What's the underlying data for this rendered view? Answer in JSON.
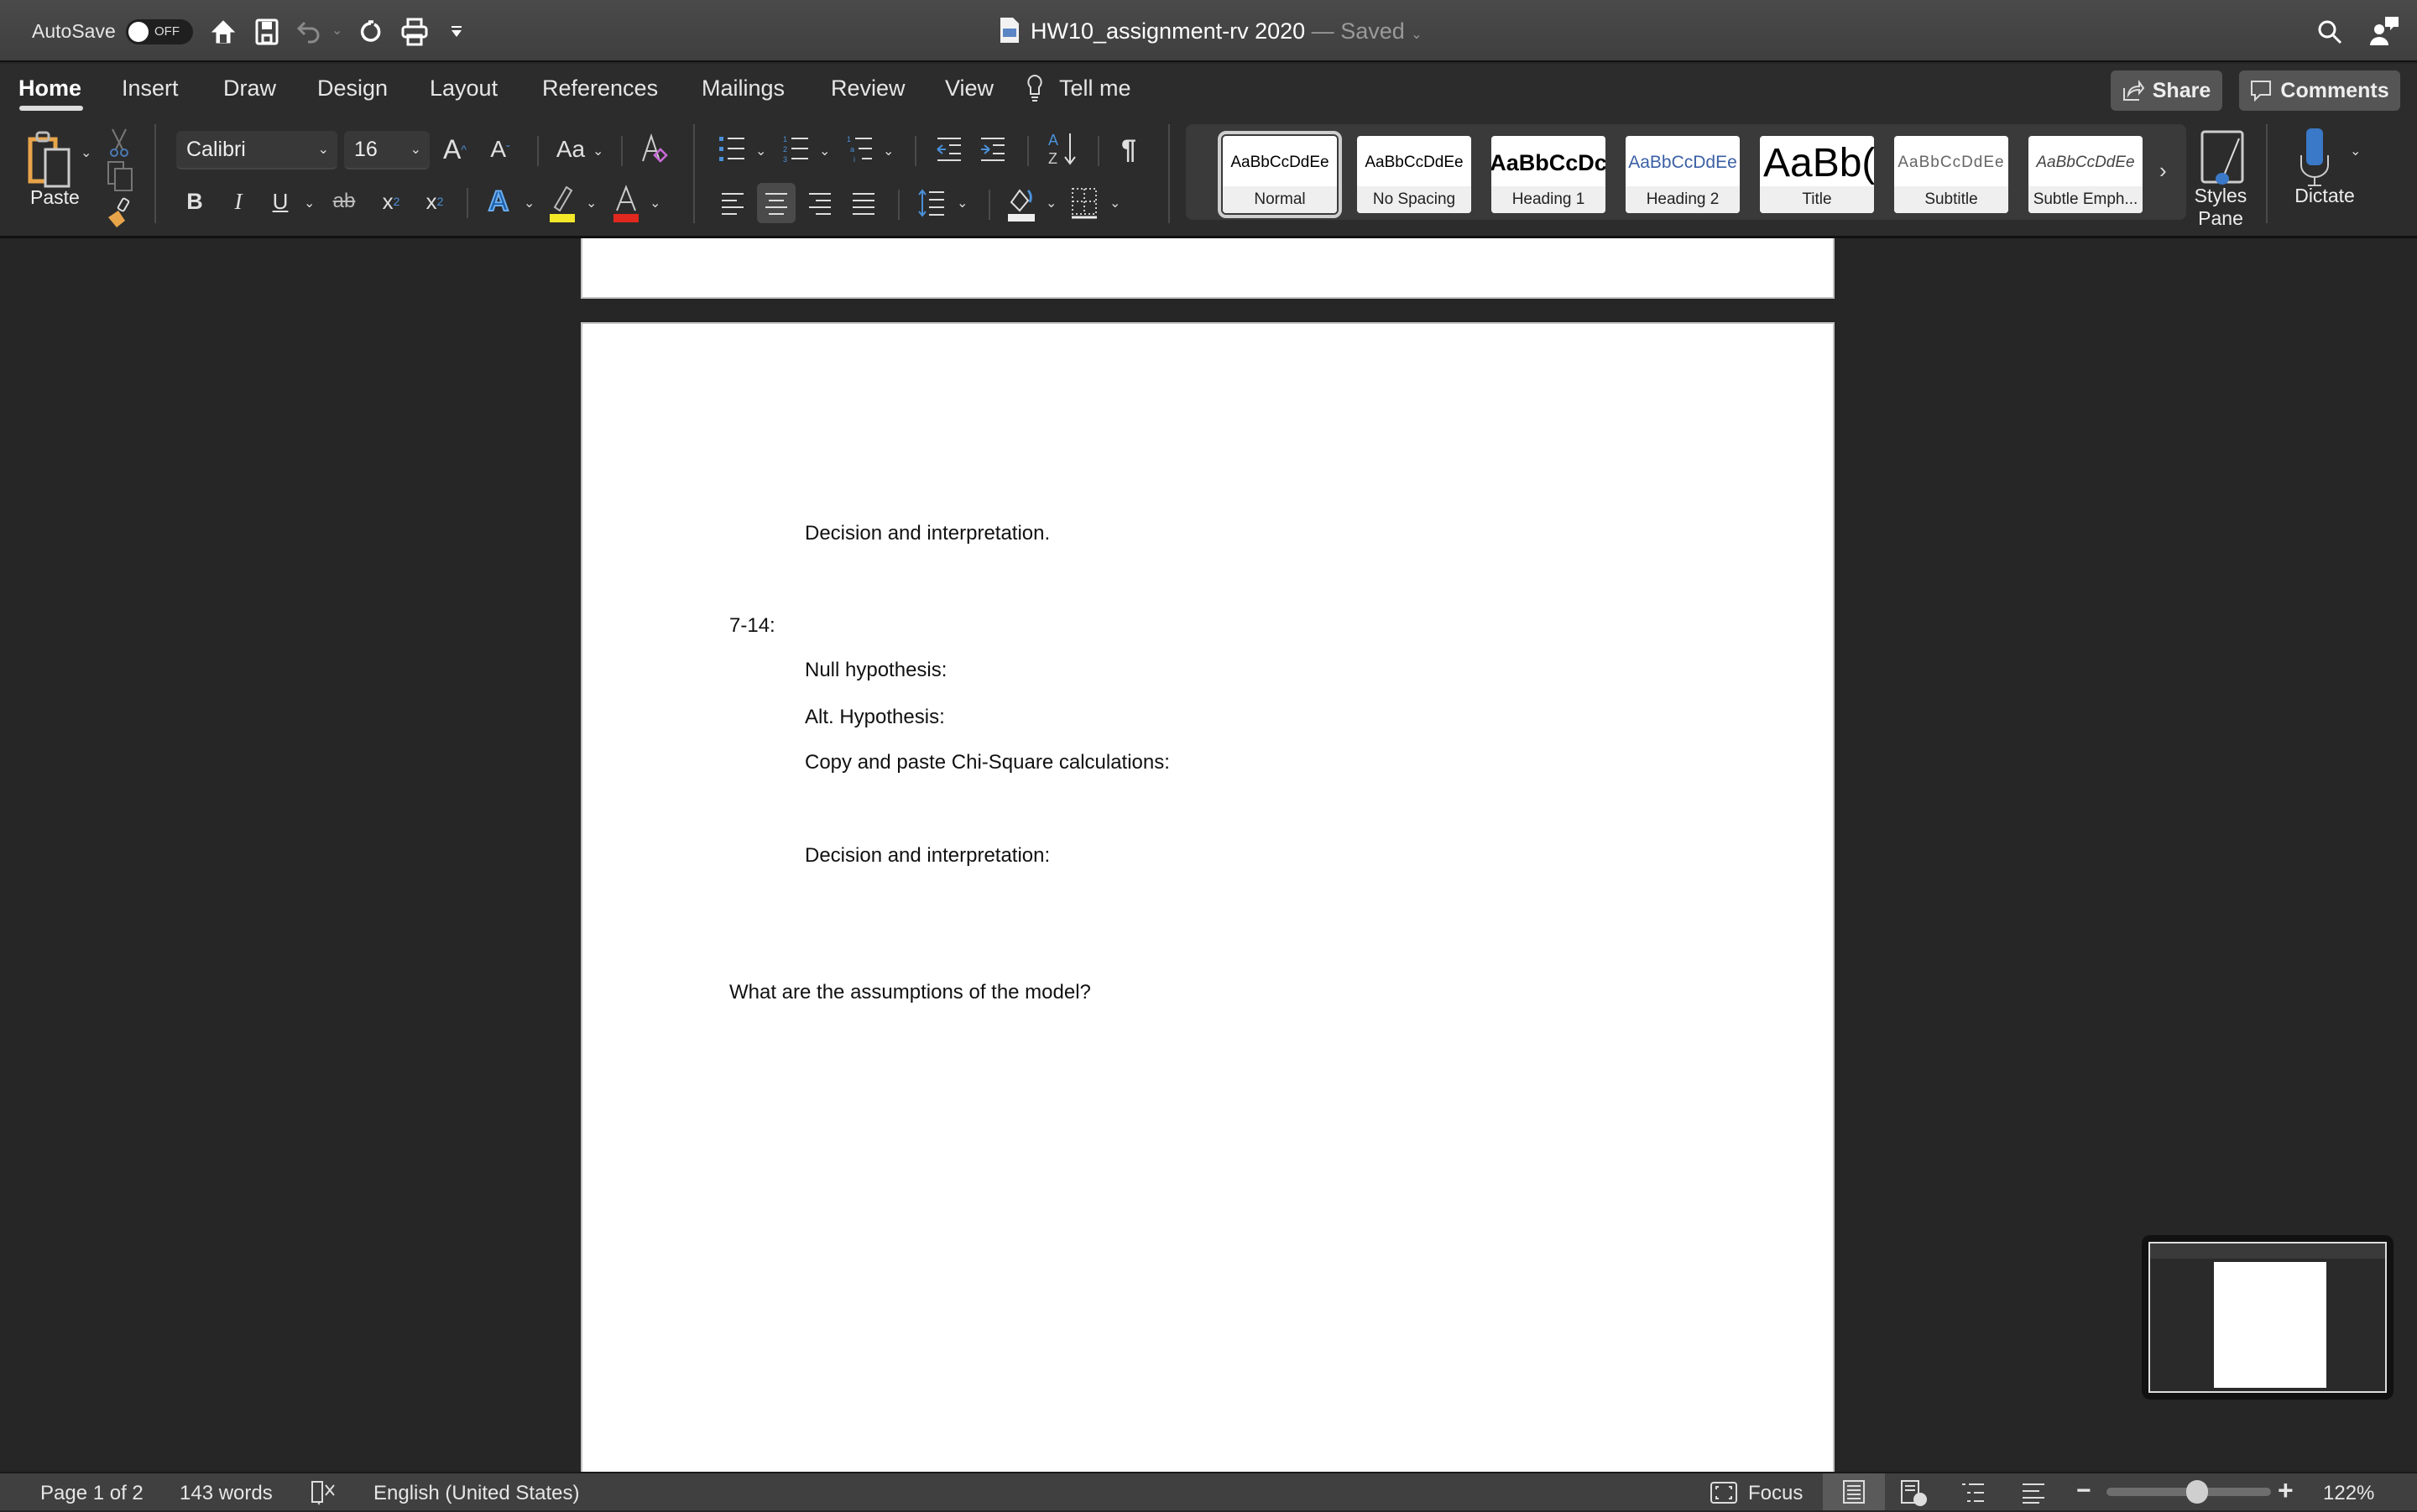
{
  "titlebar": {
    "autosave_label": "AutoSave",
    "autosave_state": "OFF",
    "doc_title": "HW10_assignment-rv 2020",
    "separator": "—",
    "save_status": "Saved",
    "icons": [
      "home-icon",
      "save-icon",
      "undo-icon",
      "redo-icon",
      "print-icon",
      "customize-toolbar-icon",
      "search-icon",
      "account-icon"
    ]
  },
  "tabs": [
    {
      "label": "Home",
      "active": true
    },
    {
      "label": "Insert"
    },
    {
      "label": "Draw"
    },
    {
      "label": "Design"
    },
    {
      "label": "Layout"
    },
    {
      "label": "References"
    },
    {
      "label": "Mailings"
    },
    {
      "label": "Review"
    },
    {
      "label": "View"
    }
  ],
  "tell_me": "Tell me",
  "share_label": "Share",
  "comments_label": "Comments",
  "ribbon": {
    "paste_label": "Paste",
    "font_name": "Calibri",
    "font_size": "16",
    "change_case": "Aa",
    "styles": [
      {
        "sample": "AaBbCcDdEe",
        "name": "Normal",
        "selected": true
      },
      {
        "sample": "AaBbCcDdEe",
        "name": "No Spacing"
      },
      {
        "sample": "AaBbCcDc",
        "name": "Heading 1"
      },
      {
        "sample": "AaBbCcDdEe",
        "name": "Heading 2"
      },
      {
        "sample": "AaBb(",
        "name": "Title"
      },
      {
        "sample": "AaBbCcDdEe",
        "name": "Subtitle"
      },
      {
        "sample": "AaBbCcDdEe",
        "name": "Subtle Emph..."
      }
    ],
    "styles_pane_label_1": "Styles",
    "styles_pane_label_2": "Pane",
    "dictate_label": "Dictate",
    "colors": {
      "highlight": "#f5e829",
      "font_color": "#e0281e",
      "accent_blue": "#4a90d9"
    }
  },
  "document": {
    "lines": [
      {
        "text": "Decision and interpretation.",
        "indent": 2
      },
      {
        "text": "7-14:",
        "indent": 1
      },
      {
        "text": "Null hypothesis:",
        "indent": 2
      },
      {
        "text": "Alt. Hypothesis:",
        "indent": 2
      },
      {
        "text": "Copy and paste Chi-Square calculations:",
        "indent": 2
      },
      {
        "text": "Decision and interpretation:",
        "indent": 2
      },
      {
        "text": "What are the assumptions of the model?",
        "indent": 1
      }
    ]
  },
  "statusbar": {
    "page": "Page 1 of 2",
    "words": "143 words",
    "language": "English (United States)",
    "focus": "Focus",
    "zoom": "122%",
    "zoom_fraction": 0.55
  }
}
